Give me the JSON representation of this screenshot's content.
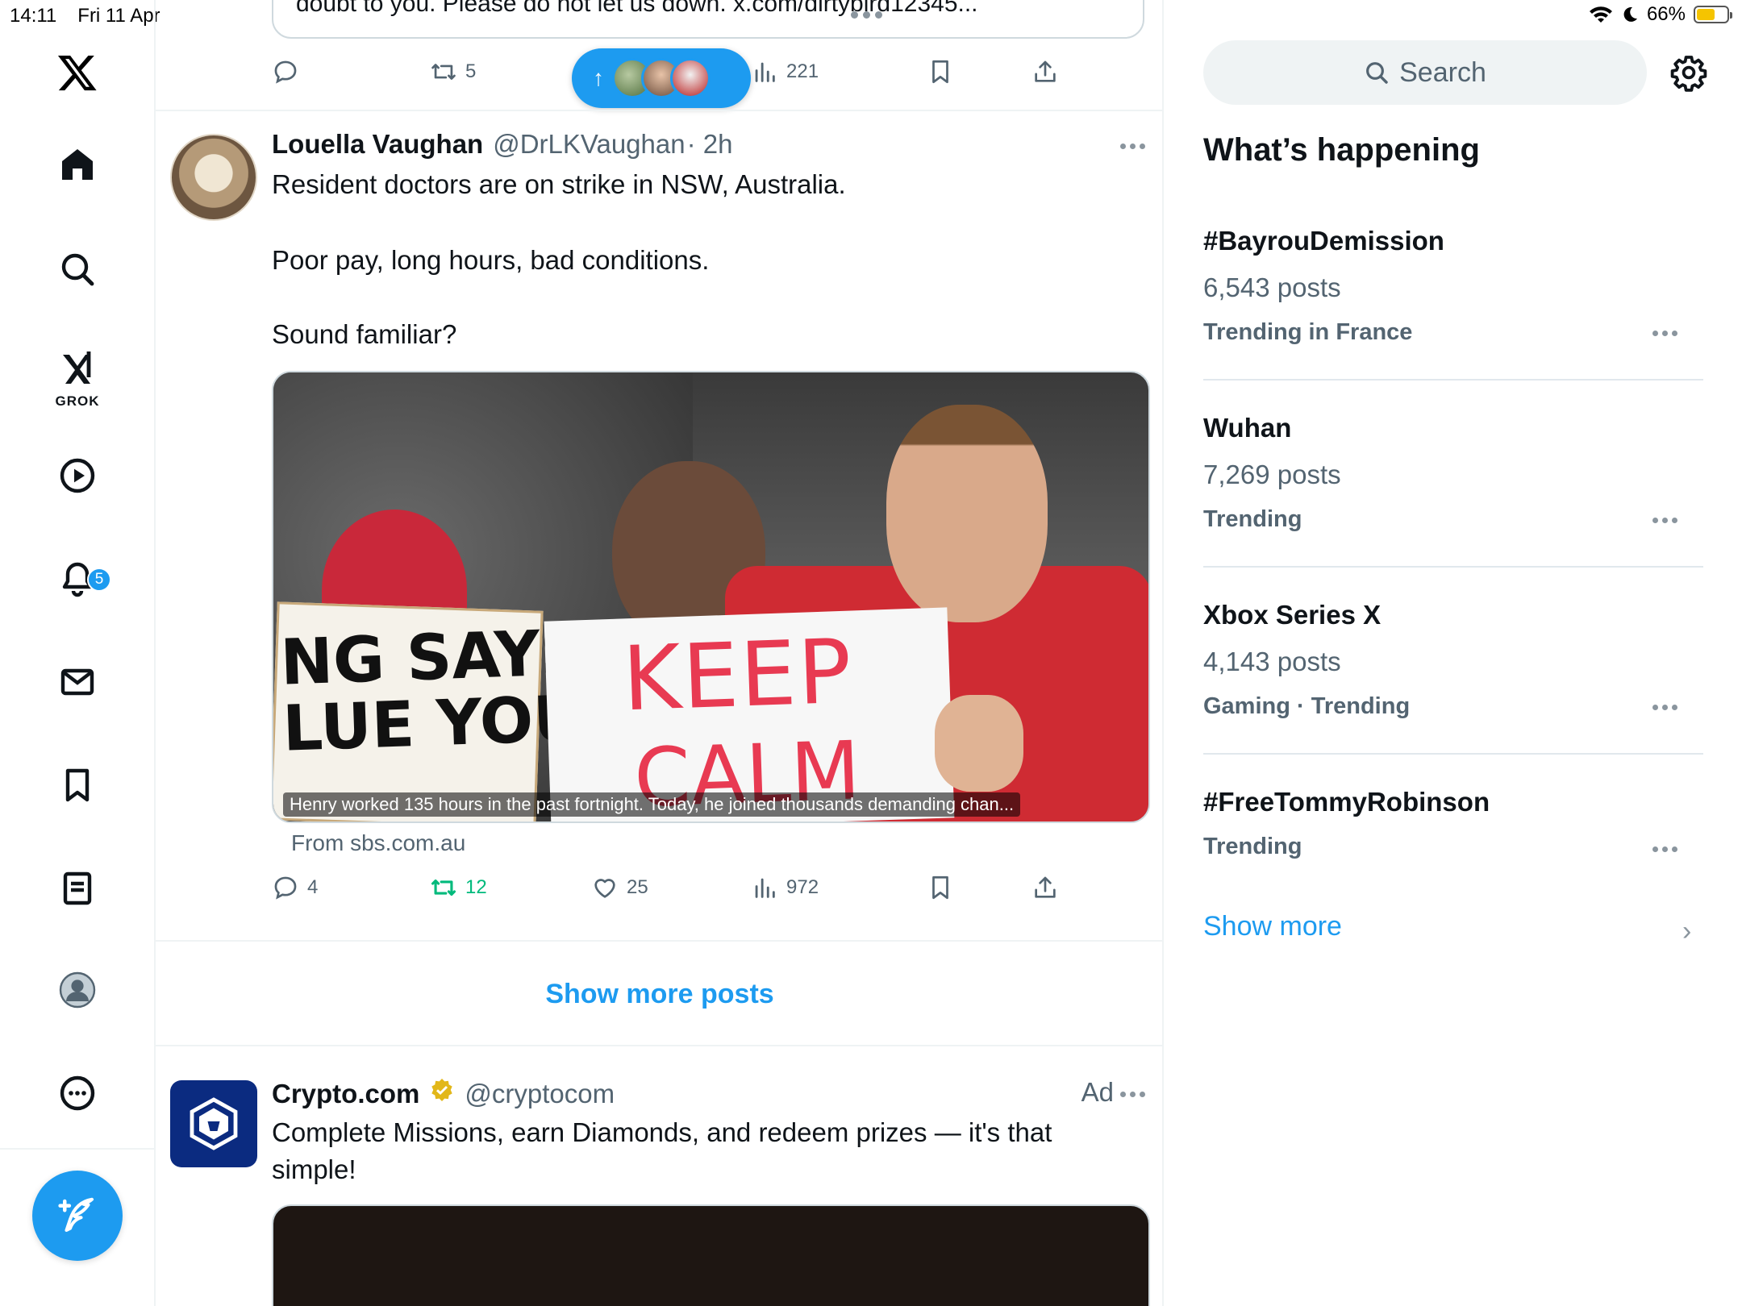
{
  "status_bar": {
    "time": "14:11",
    "date": "Fri 11 Apr",
    "battery": "66%"
  },
  "nav": {
    "notifications_badge": "5",
    "grok_label": "GROK"
  },
  "top_post": {
    "quote_text": "doubt to you. Please do not let us down. x.com/dirtybird12345...",
    "retweets": "5",
    "views": "221"
  },
  "post": {
    "author_name": "Louella Vaughan",
    "handle": "@DrLKVaughan",
    "time": "· 2h",
    "lines": [
      "Resident doctors are on strike in NSW, Australia.",
      "Poor pay, long hours, bad conditions.",
      "Sound familiar?"
    ],
    "sign_left": "NG SAYS\nLUE YOU",
    "sign_right_1": "KEEP",
    "sign_right_2": "CALM",
    "media_caption": "Henry worked 135 hours in the past fortnight. Today, he joined thousands demanding chan...",
    "source": "From sbs.com.au",
    "replies": "4",
    "retweets": "12",
    "likes": "25",
    "views": "972"
  },
  "show_more_posts": "Show more posts",
  "ad_post": {
    "author_name": "Crypto.com",
    "handle": "@cryptocom",
    "ad_label": "Ad",
    "line1": "Complete Missions, earn Diamonds, and redeem prizes — it's that",
    "line2": "simple!"
  },
  "sidebar": {
    "search_placeholder": "Search",
    "title": "What’s happening",
    "trends": [
      {
        "name": "#BayrouDemission",
        "count": "6,543 posts",
        "context": "Trending in France"
      },
      {
        "name": "Wuhan",
        "count": "7,269 posts",
        "context": "Trending"
      },
      {
        "name": "Xbox Series X",
        "count": "4,143 posts",
        "context": "Gaming · Trending"
      },
      {
        "name": "#FreeTommyRobinson",
        "count": "",
        "context": "Trending"
      }
    ],
    "show_more": "Show more"
  },
  "colors": {
    "accent": "#1d9bf0",
    "retweet_green": "#00ba7c",
    "secondary_text": "#536471"
  }
}
